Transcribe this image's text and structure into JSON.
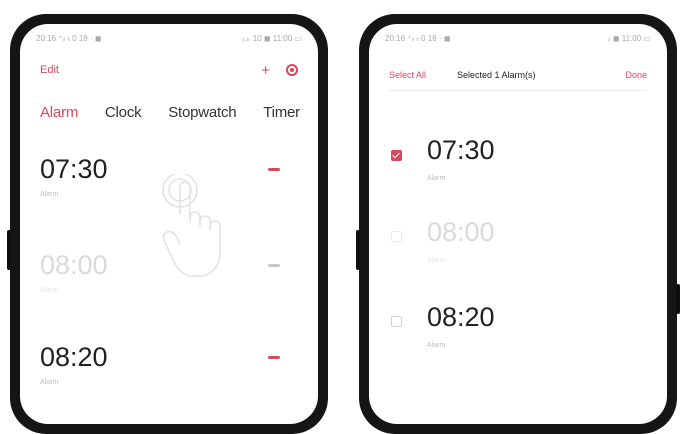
{
  "left_phone": {
    "status_bar": {
      "left": "20:16 ⁺ᵢₗ ₗₗ 0 18 · ◼",
      "right": "₀.ₖ 10 ◼ 11:00 ▭"
    },
    "toolbar": {
      "edit_label": "Edit",
      "add_icon": "plus-icon",
      "settings_icon": "gear-icon"
    },
    "tabs": [
      {
        "label": "Alarm",
        "active": true
      },
      {
        "label": "Clock",
        "active": false
      },
      {
        "label": "Stopwatch",
        "active": false
      },
      {
        "label": "Timer",
        "active": false
      }
    ],
    "alarms": [
      {
        "time": "07:30",
        "label": "Alarm",
        "enabled": true
      },
      {
        "time": "08:00",
        "label": "Alarm",
        "enabled": false
      },
      {
        "time": "08:20",
        "label": "Alarm",
        "enabled": true
      }
    ],
    "gesture_icon": "hand-tap-icon"
  },
  "right_phone": {
    "status_bar": {
      "left": "20:16 ⁺ᵢₗ ₗₗ 0 18 · ◼",
      "right": "₀ ◼ 11:00 ▭"
    },
    "selection_bar": {
      "select_all": "Select All",
      "count_label": "Selected 1 Alarm(s)",
      "done": "Done"
    },
    "alarms": [
      {
        "time": "07:30",
        "label": "Alarm",
        "checked": true,
        "enabled": true
      },
      {
        "time": "08:00",
        "label": "Alarm",
        "checked": false,
        "enabled": false
      },
      {
        "time": "08:20",
        "label": "Alarm",
        "checked": false,
        "enabled": true
      }
    ]
  },
  "colors": {
    "accent": "#d9485e",
    "frame": "#151515"
  }
}
